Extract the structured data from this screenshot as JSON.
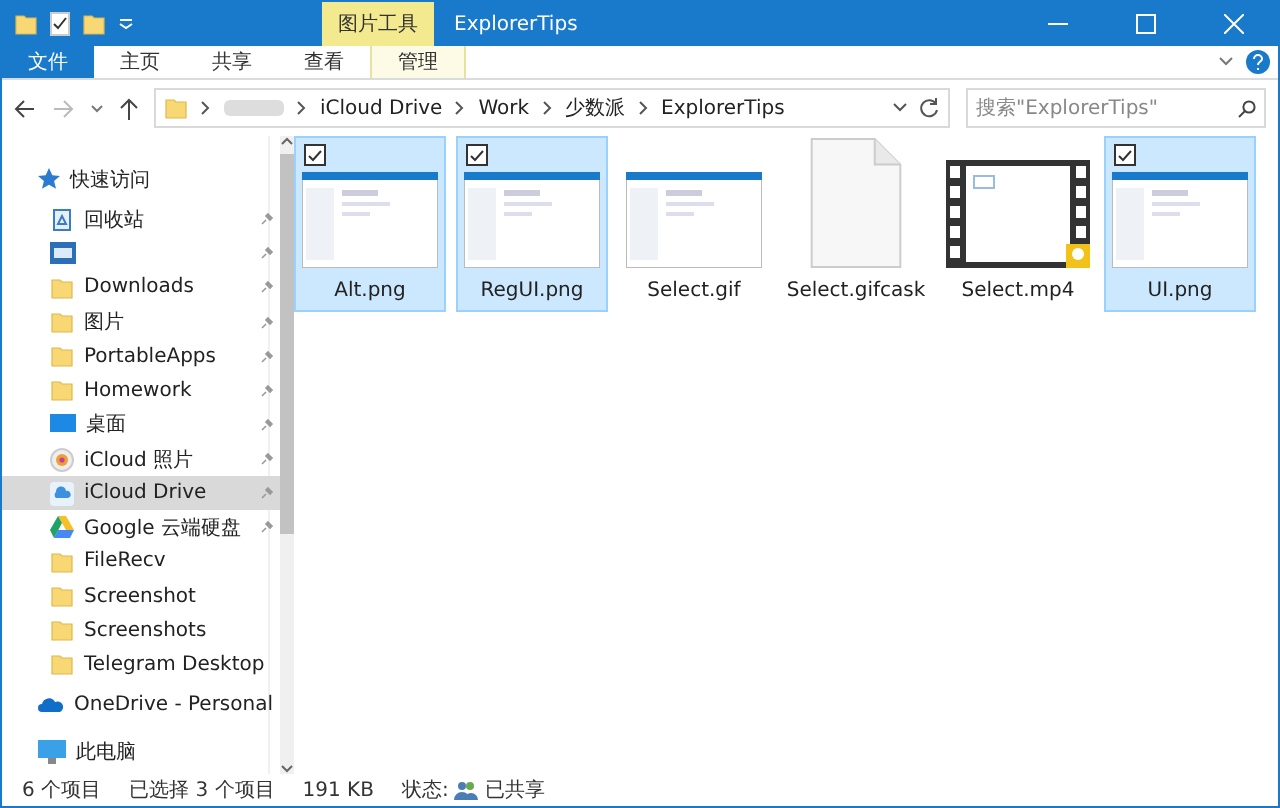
{
  "window": {
    "title": "ExplorerTips",
    "context_tab": "图片工具"
  },
  "ribbon_tabs": [
    {
      "label": "文件",
      "kind": "file",
      "selected": false
    },
    {
      "label": "主页",
      "kind": "tab",
      "selected": false
    },
    {
      "label": "共享",
      "kind": "tab",
      "selected": false
    },
    {
      "label": "查看",
      "kind": "tab",
      "selected": false
    },
    {
      "label": "管理",
      "kind": "context",
      "selected": false
    }
  ],
  "breadcrumb": [
    "iCloud Drive",
    "Work",
    "少数派",
    "ExplorerTips"
  ],
  "search": {
    "placeholder": "搜索\"ExplorerTips\""
  },
  "sidebar": {
    "items": [
      {
        "label": "快速访问",
        "kind": "star",
        "pinned": false,
        "selected": false,
        "section": true
      },
      {
        "label": "回收站",
        "kind": "recycle",
        "pinned": true,
        "selected": false,
        "section": false
      },
      {
        "kind": "app",
        "pinned": true,
        "selected": false,
        "section": false
      },
      {
        "label": "Downloads",
        "kind": "folder",
        "pinned": true,
        "selected": false,
        "section": false
      },
      {
        "label": "图片",
        "kind": "folder",
        "pinned": true,
        "selected": false,
        "section": false
      },
      {
        "label": "PortableApps",
        "kind": "folder",
        "pinned": true,
        "selected": false,
        "section": false
      },
      {
        "label": "Homework",
        "kind": "folder",
        "pinned": true,
        "selected": false,
        "section": false
      },
      {
        "label": "桌面",
        "kind": "desktop",
        "pinned": true,
        "selected": false,
        "section": false
      },
      {
        "label": "iCloud 照片",
        "kind": "photos",
        "pinned": true,
        "selected": false,
        "section": false
      },
      {
        "label": "iCloud Drive",
        "kind": "cloud",
        "pinned": true,
        "selected": true,
        "section": false
      },
      {
        "label": "Google 云端硬盘",
        "kind": "google",
        "pinned": true,
        "selected": false,
        "section": false
      },
      {
        "label": "FileRecv",
        "kind": "folder",
        "pinned": false,
        "selected": false,
        "section": false
      },
      {
        "label": "Screenshot",
        "kind": "folder",
        "pinned": false,
        "selected": false,
        "section": false
      },
      {
        "label": "Screenshots",
        "kind": "folder",
        "pinned": false,
        "selected": false,
        "section": false
      },
      {
        "label": "Telegram Desktop",
        "kind": "folder",
        "pinned": false,
        "selected": false,
        "section": false
      },
      {
        "label": "OneDrive - Personal",
        "kind": "onedrive",
        "pinned": false,
        "selected": false,
        "section": true
      },
      {
        "label": "此电脑",
        "kind": "pc",
        "pinned": false,
        "selected": false,
        "section": true
      }
    ]
  },
  "files": [
    {
      "name": "Alt.png",
      "kind": "image",
      "selected": true
    },
    {
      "name": "RegUI.png",
      "kind": "image",
      "selected": true
    },
    {
      "name": "Select.gif",
      "kind": "image",
      "selected": false
    },
    {
      "name": "Select.gifcask",
      "kind": "document",
      "selected": false
    },
    {
      "name": "Select.mp4",
      "kind": "video",
      "selected": false
    },
    {
      "name": "UI.png",
      "kind": "image",
      "selected": true
    }
  ],
  "status_bar": {
    "count": "6 个项目",
    "selection": "已选择 3 个项目",
    "size": "191 KB",
    "state_label": "状态:",
    "state": "已共享"
  }
}
